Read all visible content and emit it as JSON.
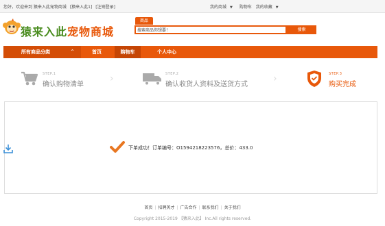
{
  "topbar": {
    "greeting": "您好，欢迎来到 猿来入此宠物商城",
    "login": "[猿来入此1]",
    "logout": "[注销登录]",
    "my_shop": "我的商城",
    "cart": "购物车",
    "favorites": "我的收藏"
  },
  "header": {
    "logo_text_a": "猿来入此",
    "logo_text_b": "宠物商城",
    "search_tab": "商品",
    "search_value": "搜索商品你想要！",
    "search_button": "搜索"
  },
  "nav": {
    "all_categories": "所有商品分类",
    "home": "首页",
    "cart": "购物车",
    "user_center": "个人中心"
  },
  "steps": [
    {
      "no": "STEP.1",
      "label": "确认购物清单",
      "active": false,
      "icon": "cart-icon"
    },
    {
      "no": "STEP.2",
      "label": "确认收货人资料及送货方式",
      "active": false,
      "icon": "truck-icon"
    },
    {
      "no": "STEP.3",
      "label": "购买完成",
      "active": true,
      "icon": "shield-check-icon"
    }
  ],
  "result": {
    "message": "下单成功！订单编号：O1594218223576，总价：433.0"
  },
  "footer": {
    "links": [
      "首页",
      "招聘英才",
      "广告合作",
      "联系我们",
      "关于我们"
    ],
    "copyright": "Copyright 2015-2019 【猿来入此】 Inc.All rights reserved."
  },
  "colors": {
    "accent": "#e8580a",
    "logo_green": "#4a8c1f",
    "success_orange": "#e87722"
  }
}
